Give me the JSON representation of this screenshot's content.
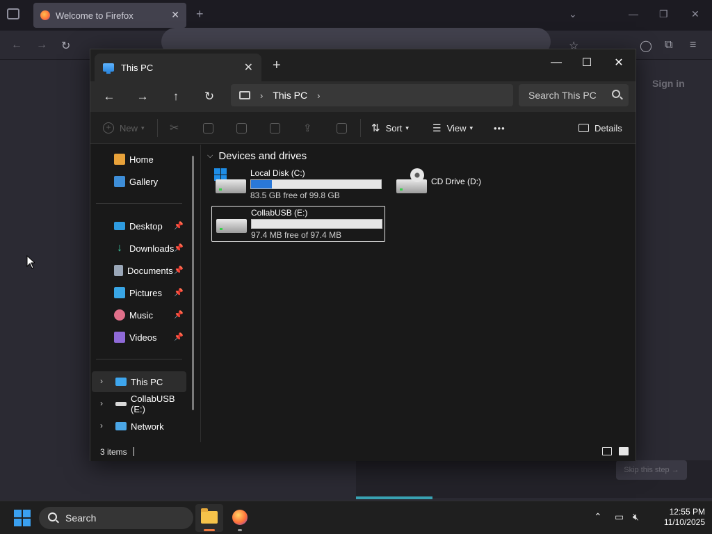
{
  "firefox": {
    "tab_title": "Welcome to Firefox",
    "new_tab": "+",
    "sign_in": "Sign in",
    "skip": "Skip this step →"
  },
  "explorer": {
    "tab_title": "This PC",
    "tab_close": "✕",
    "new_tab": "+",
    "window": {
      "minimize": "—",
      "maximize": "☐",
      "close": "✕"
    },
    "nav": {
      "back": "←",
      "forward": "→",
      "up": "↑",
      "refresh": "↻"
    },
    "address": {
      "crumb": "This PC",
      "chevron": "›"
    },
    "search": {
      "placeholder": "Search This PC"
    },
    "command_bar": {
      "new": "New",
      "sort": "Sort",
      "view": "View",
      "more": "•••",
      "details": "Details"
    },
    "sidebar": {
      "quick": [
        {
          "label": "Home",
          "pinned": false
        },
        {
          "label": "Gallery",
          "pinned": false
        }
      ],
      "pinned": [
        {
          "label": "Desktop"
        },
        {
          "label": "Downloads"
        },
        {
          "label": "Documents"
        },
        {
          "label": "Pictures"
        },
        {
          "label": "Music"
        },
        {
          "label": "Videos"
        }
      ],
      "tree": [
        {
          "label": "This PC"
        },
        {
          "label": "CollabUSB (E:)"
        },
        {
          "label": "Network"
        }
      ]
    },
    "group_title": "Devices and drives",
    "drives": [
      {
        "name": "Local Disk (C:)",
        "free_text": "83.5 GB free of 99.8 GB",
        "used_fraction": 0.163
      },
      {
        "name": "CD Drive (D:)"
      },
      {
        "name": "CollabUSB (E:)",
        "free_text": "97.4 MB free of 97.4 MB",
        "used_fraction": 0.0
      }
    ],
    "status": {
      "item_count": "3 items"
    }
  },
  "taskbar": {
    "search_label": "Search",
    "time": "12:55 PM",
    "date": "11/10/2025"
  },
  "colors": {
    "accent": "#2a78d8",
    "background": "#191919",
    "selection": "#2d2d2d"
  }
}
